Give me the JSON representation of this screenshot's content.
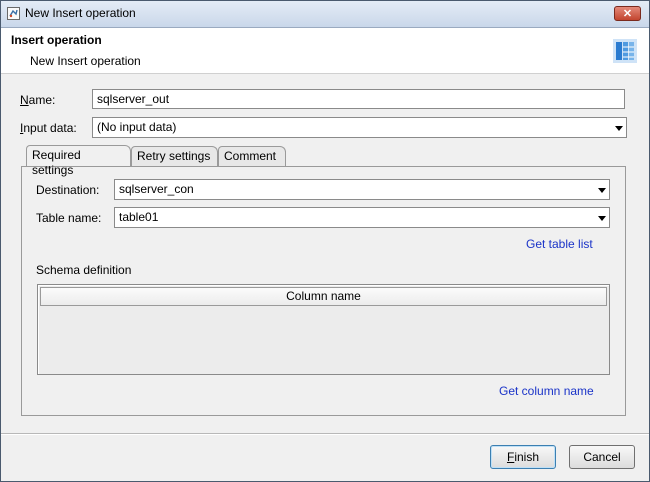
{
  "window": {
    "title": "New Insert operation",
    "close_glyph": "✕"
  },
  "banner": {
    "title": "Insert operation",
    "subtitle": "New Insert operation",
    "icon": "table-columns-icon"
  },
  "form": {
    "name_label_prefix": "N",
    "name_label_rest": "ame:",
    "name_value": "sqlserver_out",
    "input_label_prefix": "I",
    "input_label_rest": "nput data:",
    "input_value": "(No input data)"
  },
  "tabs": [
    {
      "label": "Required settings",
      "active": true
    },
    {
      "label": "Retry settings",
      "active": false
    },
    {
      "label": "Comment",
      "active": false
    }
  ],
  "required": {
    "destination_label": "Destination:",
    "destination_value": "sqlserver_con",
    "table_label": "Table name:",
    "table_value": "table01",
    "get_table_list": "Get table list",
    "schema_label": "Schema definition",
    "column_header": "Column name",
    "get_column_name": "Get column name"
  },
  "buttons": {
    "finish_prefix": "F",
    "finish_rest": "inish",
    "cancel": "Cancel"
  },
  "colors": {
    "link": "#1a33c8",
    "close": "#c2452f"
  }
}
